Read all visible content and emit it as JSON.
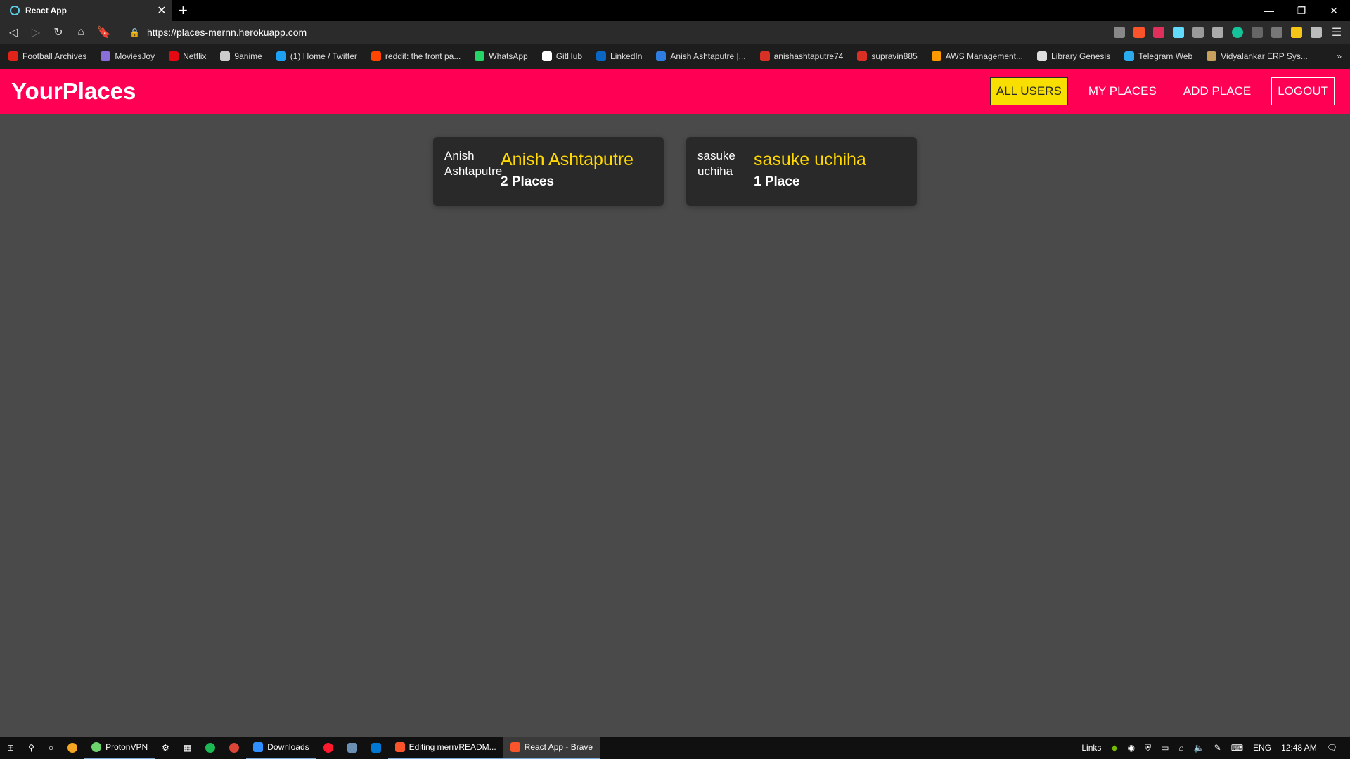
{
  "browser": {
    "tab_title": "React App",
    "tab_close": "✕",
    "new_tab": "+",
    "url": "https://places-mernn.herokuapp.com",
    "win_min": "—",
    "win_restore": "❐",
    "win_close": "✕",
    "bookmarks": [
      {
        "label": "Football Archives",
        "color": "#e2231a"
      },
      {
        "label": "MoviesJoy",
        "color": "#8a6fd8"
      },
      {
        "label": "Netflix",
        "color": "#e50914"
      },
      {
        "label": "9anime",
        "color": "#cccccc"
      },
      {
        "label": "(1) Home / Twitter",
        "color": "#1da1f2"
      },
      {
        "label": "reddit: the front pa...",
        "color": "#ff4500"
      },
      {
        "label": "WhatsApp",
        "color": "#25d366"
      },
      {
        "label": "GitHub",
        "color": "#ffffff"
      },
      {
        "label": "LinkedIn",
        "color": "#0a66c2"
      },
      {
        "label": "Anish Ashtaputre |...",
        "color": "#2f7de1"
      },
      {
        "label": "anishashtaputre74",
        "color": "#d93025"
      },
      {
        "label": "supravin885",
        "color": "#d93025"
      },
      {
        "label": "AWS Management...",
        "color": "#ff9900"
      },
      {
        "label": "Library Genesis",
        "color": "#dddddd"
      },
      {
        "label": "Telegram Web",
        "color": "#2aabee"
      },
      {
        "label": "Vidyalankar ERP Sys...",
        "color": "#c8a25c"
      }
    ],
    "more": "»"
  },
  "app": {
    "logo": "YourPlaces",
    "nav": {
      "all_users": "ALL USERS",
      "my_places": "MY PLACES",
      "add_place": "ADD PLACE",
      "logout": "LOGOUT"
    },
    "users": [
      {
        "avatar_alt": "Anish Ashtaputre",
        "name": "Anish Ashtaputre",
        "places": "2 Places"
      },
      {
        "avatar_alt": "sasuke uchiha",
        "name": "sasuke uchiha",
        "places": "1 Place"
      }
    ],
    "accent": "#ff0055",
    "highlight": "#ffd900"
  },
  "taskbar": {
    "apps": [
      {
        "label": "ProtonVPN",
        "color": "#6dd36d"
      },
      {
        "label": "Downloads",
        "color": "#2f8fff"
      },
      {
        "label": "Editing mern/READM...",
        "color": "#fb542b"
      },
      {
        "label": "React App - Brave",
        "color": "#fb542b"
      }
    ],
    "links": "Links",
    "lang": "ENG",
    "time": "12:48 AM"
  }
}
